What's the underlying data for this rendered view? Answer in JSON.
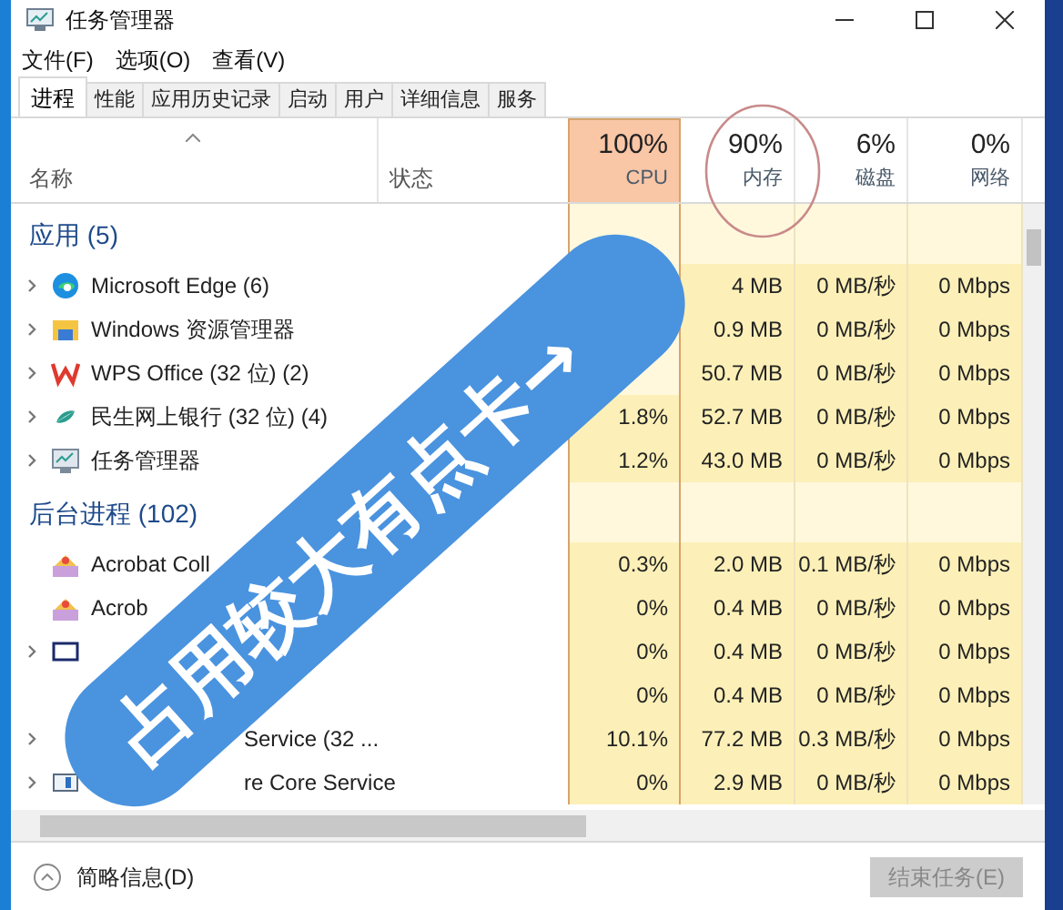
{
  "window": {
    "title": "任务管理器"
  },
  "menu": [
    "文件(F)",
    "选项(O)",
    "查看(V)"
  ],
  "tabs": [
    {
      "label": "进程",
      "selected": true
    },
    {
      "label": "性能",
      "selected": false
    },
    {
      "label": "应用历史记录",
      "selected": false
    },
    {
      "label": "启动",
      "selected": false
    },
    {
      "label": "用户",
      "selected": false
    },
    {
      "label": "详细信息",
      "selected": false
    },
    {
      "label": "服务",
      "selected": false
    }
  ],
  "columns": [
    {
      "kind": "name",
      "label": "名称"
    },
    {
      "kind": "status",
      "label": "状态"
    },
    {
      "kind": "metric",
      "usage": "100%",
      "label": "CPU",
      "hot": true
    },
    {
      "kind": "metric",
      "usage": "90%",
      "label": "内存",
      "hot": false
    },
    {
      "kind": "metric",
      "usage": "6%",
      "label": "磁盘",
      "hot": false
    },
    {
      "kind": "metric",
      "usage": "0%",
      "label": "网络",
      "hot": false
    }
  ],
  "groups": [
    {
      "title": "应用 (5)",
      "processes": [
        {
          "kind": "edge",
          "name": "Microsoft Edge (6)",
          "expandable": true,
          "memory": "4 MB",
          "disk": "0 MB/秒",
          "network": "0 Mbps"
        },
        {
          "kind": "folder",
          "name": "Windows 资源管理器",
          "expandable": true,
          "memory": "0.9 MB",
          "disk": "0 MB/秒",
          "network": "0 Mbps"
        },
        {
          "kind": "wps",
          "name": "WPS Office (32 位) (2)",
          "expandable": true,
          "memory": "50.7 MB",
          "disk": "0 MB/秒",
          "network": "0 Mbps"
        },
        {
          "kind": "bank",
          "name": "民生网上银行 (32 位) (4)",
          "expandable": true,
          "cpu": "1.8%",
          "memory": "52.7 MB",
          "disk": "0 MB/秒",
          "network": "0 Mbps"
        },
        {
          "kind": "taskmgr",
          "name": "任务管理器",
          "expandable": true,
          "cpu": "1.2%",
          "memory": "43.0 MB",
          "disk": "0 MB/秒",
          "network": "0 Mbps"
        }
      ]
    },
    {
      "title": "后台进程 (102)",
      "processes": [
        {
          "kind": "acrobat",
          "name": "Acrobat Coll",
          "expandable": false,
          "cpu": "0.3%",
          "memory": "2.0 MB",
          "disk": "0.1 MB/秒",
          "network": "0 Mbps"
        },
        {
          "kind": "acrobat",
          "name": "Acrob",
          "expandable": false,
          "cpu": "0%",
          "memory": "0.4 MB",
          "disk": "0 MB/秒",
          "network": "0 Mbps"
        },
        {
          "kind": "window",
          "expandable": true,
          "cpu": "0%",
          "memory": "0.4 MB",
          "disk": "0 MB/秒",
          "network": "0 Mbps"
        },
        {
          "kind": "hidden",
          "expandable": false,
          "cpu": "0%",
          "memory": "0.4 MB",
          "disk": "0 MB/秒",
          "network": "0 Mbps"
        },
        {
          "kind": "hidden",
          "name": "Service (32 ...",
          "name_cut": true,
          "expandable": true,
          "cpu": "10.1%",
          "memory": "77.2 MB",
          "disk": "0.3 MB/秒",
          "network": "0 Mbps"
        },
        {
          "kind": "service",
          "name": "re Core Service",
          "name_cut": true,
          "expandable": true,
          "cpu": "0%",
          "memory": "2.9 MB",
          "disk": "0 MB/秒",
          "network": "0 Mbps"
        }
      ]
    }
  ],
  "annotation": {
    "text": "占用较大有点卡→"
  },
  "footer": {
    "details": "简略信息(D)",
    "end_task": {
      "label": "结束任务(E)",
      "disabled": true
    }
  }
}
